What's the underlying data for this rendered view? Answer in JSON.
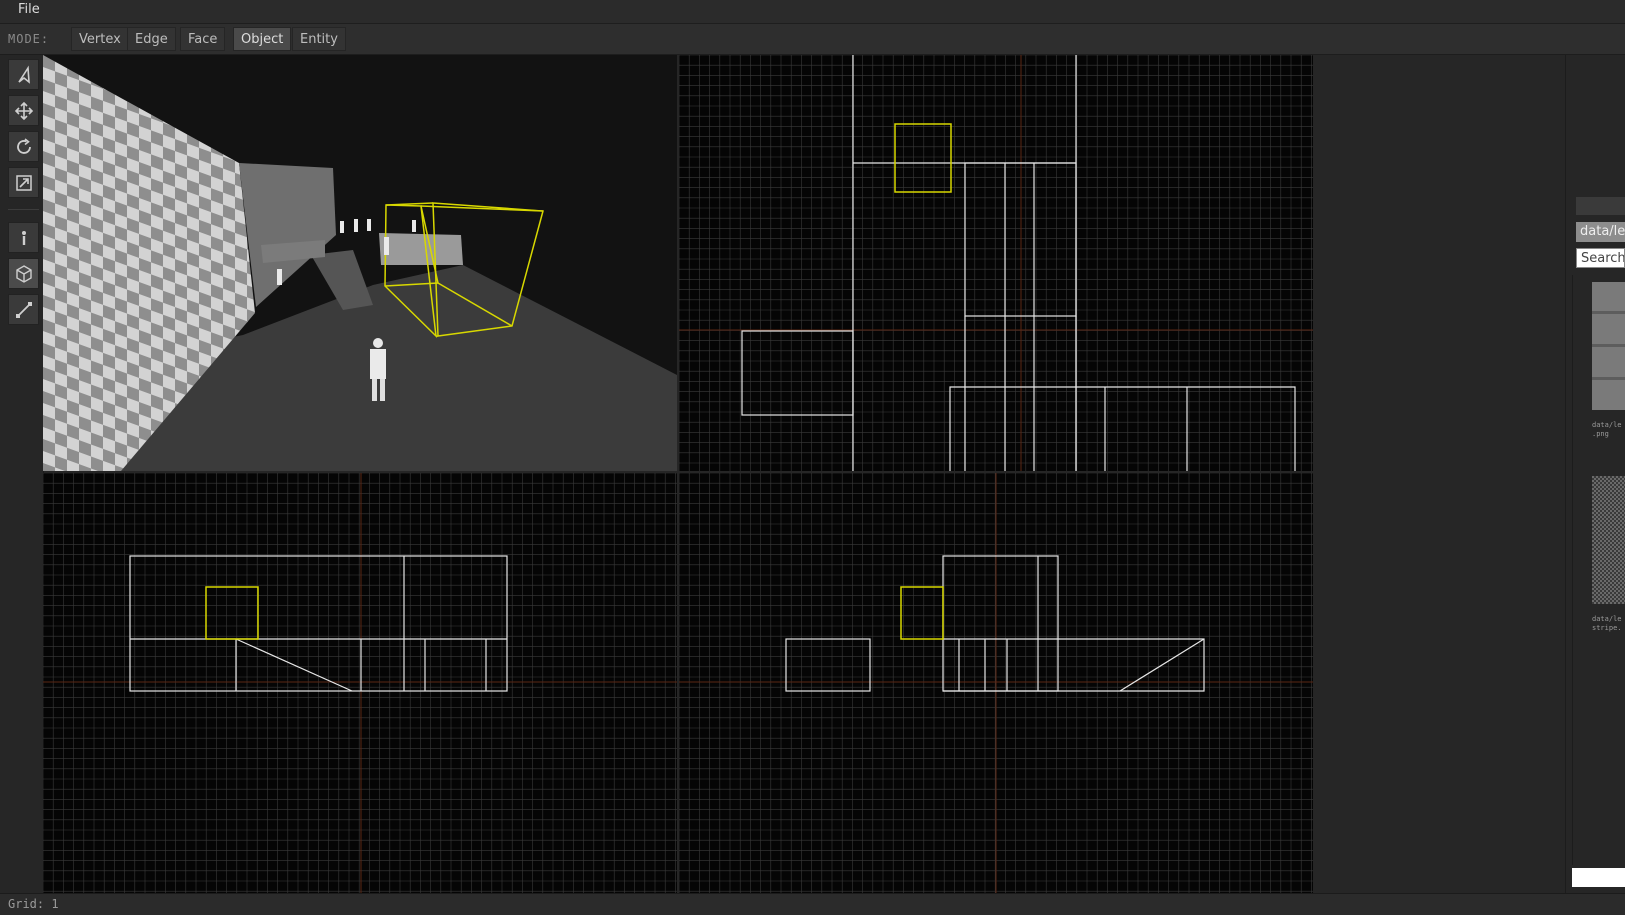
{
  "menu": {
    "file": "File"
  },
  "modebar": {
    "label": "MODE:",
    "modes": [
      "Vertex",
      "Edge",
      "Face",
      "Object",
      "Entity"
    ],
    "active": "Object"
  },
  "tools": [
    "select-icon",
    "move-icon",
    "rotate-icon",
    "scale-icon",
    "entity-icon",
    "brush-icon",
    "line-icon"
  ],
  "viewports": {
    "perspective": "3D perspective",
    "top": "2D",
    "front": "2D",
    "side": "2D"
  },
  "asset_panel": {
    "path": "data/lev",
    "search_placeholder": "Search",
    "items": [
      {
        "caption": "data/le\n.png"
      },
      {
        "caption": "data/le\nstripe."
      }
    ]
  },
  "status": {
    "grid": "Grid: 1"
  },
  "colors": {
    "selection": "#d8d800",
    "grid": "#3a3a3a",
    "axis": "#5a2614",
    "background": "#050505"
  }
}
